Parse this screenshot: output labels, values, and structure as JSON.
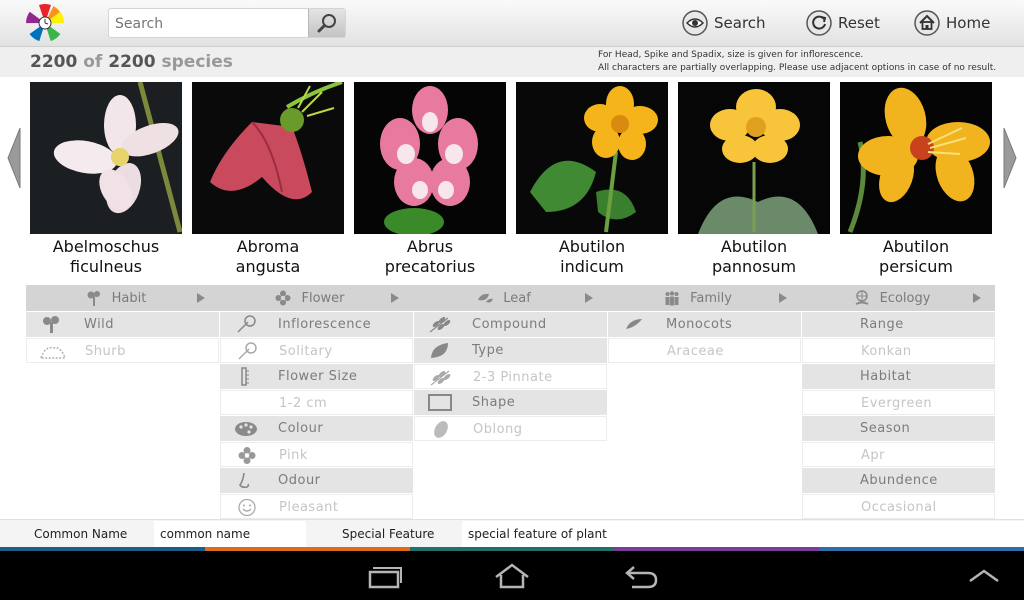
{
  "search": {
    "placeholder": "Search"
  },
  "header": {
    "actions": [
      {
        "label": "Search",
        "icon": "eye-icon"
      },
      {
        "label": "Reset",
        "icon": "reset-icon"
      },
      {
        "label": "Home",
        "icon": "home-icon"
      }
    ]
  },
  "summary": {
    "shown": "2200",
    "of_word": "of",
    "total": "2200",
    "unit_word": "species",
    "note_1": "For Head, Spike and Spadix, size is given for inflorescence.",
    "note_2": "All characters are partially overlapping. Please use adjacent options in case of no result."
  },
  "species": [
    {
      "genus": "Abelmoschus",
      "epithet": "ficulneus"
    },
    {
      "genus": "Abroma",
      "epithet": "angusta"
    },
    {
      "genus": "Abrus",
      "epithet": "precatorius"
    },
    {
      "genus": "Abutilon",
      "epithet": "indicum"
    },
    {
      "genus": "Abutilon",
      "epithet": "pannosum"
    },
    {
      "genus": "Abutilon",
      "epithet": "persicum"
    }
  ],
  "categories": [
    {
      "label": "Habit",
      "icon": "tree-icon"
    },
    {
      "label": "Flower",
      "icon": "flower-icon"
    },
    {
      "label": "Leaf",
      "icon": "leaf-icon"
    },
    {
      "label": "Family",
      "icon": "people-icon"
    },
    {
      "label": "Ecology",
      "icon": "globe-hand-icon"
    }
  ],
  "habit": {
    "h1": "Wild",
    "v1": "Shurb"
  },
  "flower": {
    "h1": "Inflorescence",
    "v1": "Solitary",
    "h2": "Flower Size",
    "v2": "1-2 cm",
    "h3": "Colour",
    "v3": "Pink",
    "h4": "Odour",
    "v4": "Pleasant"
  },
  "leaf": {
    "h1": "Compound",
    "h2": "Type",
    "v2": "2-3 Pinnate",
    "h3": "Shape",
    "v3": "Oblong"
  },
  "family": {
    "h1": "Monocots",
    "v1": "Araceae"
  },
  "ecology": {
    "h1": "Range",
    "v1": "Konkan",
    "h2": "Habitat",
    "v2": "Evergreen",
    "h3": "Season",
    "v3": "Apr",
    "h4": "Abundence",
    "v4": "Occasional"
  },
  "fields": {
    "common_label": "Common Name",
    "common_value": "common name",
    "special_label": "Special Feature",
    "special_value": "special feature of plant"
  },
  "colors": {
    "stripe_1": "#1c5f86",
    "stripe_2": "#e06a1c",
    "stripe_3": "#23706a",
    "stripe_4": "#7a3f95",
    "stripe_5": "#2f6fa8"
  }
}
